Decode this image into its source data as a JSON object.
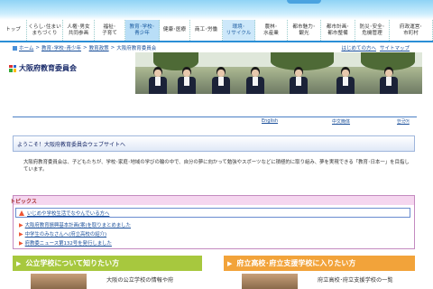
{
  "nav": {
    "items": [
      {
        "label": "トップ"
      },
      {
        "label": "くらし･住まい\nまちづくり"
      },
      {
        "label": "人権･男女\n共同参画"
      },
      {
        "label": "福祉･\n子育て"
      },
      {
        "label": "教育･学校･\n青少年"
      },
      {
        "label": "健康･医療"
      },
      {
        "label": "商工･労働"
      },
      {
        "label": "環境･\nリサイクル"
      },
      {
        "label": "農林･\n水産業"
      },
      {
        "label": "都市魅力･\n観光"
      },
      {
        "label": "都市計画･\n都市整備"
      },
      {
        "label": "防災･安全･\n危機管理"
      },
      {
        "label": "府政運営･\n市町村"
      }
    ]
  },
  "breadcrumb": {
    "home": "ホーム",
    "sep": ">",
    "level1": "教育･学校･青少年",
    "level2": "教育政策",
    "current": "大阪府教育委員会"
  },
  "toplinks": {
    "first_visit": "はじめての方へ",
    "sitemap": "サイトマップ"
  },
  "site": {
    "title": "大阪府教育委員会"
  },
  "languages": {
    "english": "English",
    "chinese": "中文簡体",
    "korean": "한국어"
  },
  "welcome": {
    "heading": "ようこそ！大阪府教育委員会ウェブサイトへ",
    "intro": "大阪府教育委員会は、子どもたちが、学校･家庭･地域の学びの輪の中で、自分の夢に向かって勉強やスポーツなどに積極的に取り組み、夢を実現できる「教育･日本一」を目指しています。"
  },
  "topics": {
    "heading": "トピックス",
    "alert": "いじめや学校生活でなやんでいる方へ",
    "news": [
      "大阪府教育振興基本計画(案)を取りまとめました",
      "中学生のみなさんへ(府立高校の紹介)",
      "府教委ニュース第132号を発行しました"
    ]
  },
  "cards": {
    "left": {
      "title": "公立学校について知りたい方",
      "text": "大阪の公立学校の情報や府"
    },
    "right": {
      "title": "府立高校･府立支援学校に入りたい方",
      "text": "府立高校･府立支援学校の一覧"
    }
  },
  "colors": {
    "nav_active": "#b9def7",
    "welcome_border": "#9fb6dc",
    "topics_head": "#f5d6ef",
    "card_left": "#a7c83e",
    "card_right": "#f2a33a"
  }
}
